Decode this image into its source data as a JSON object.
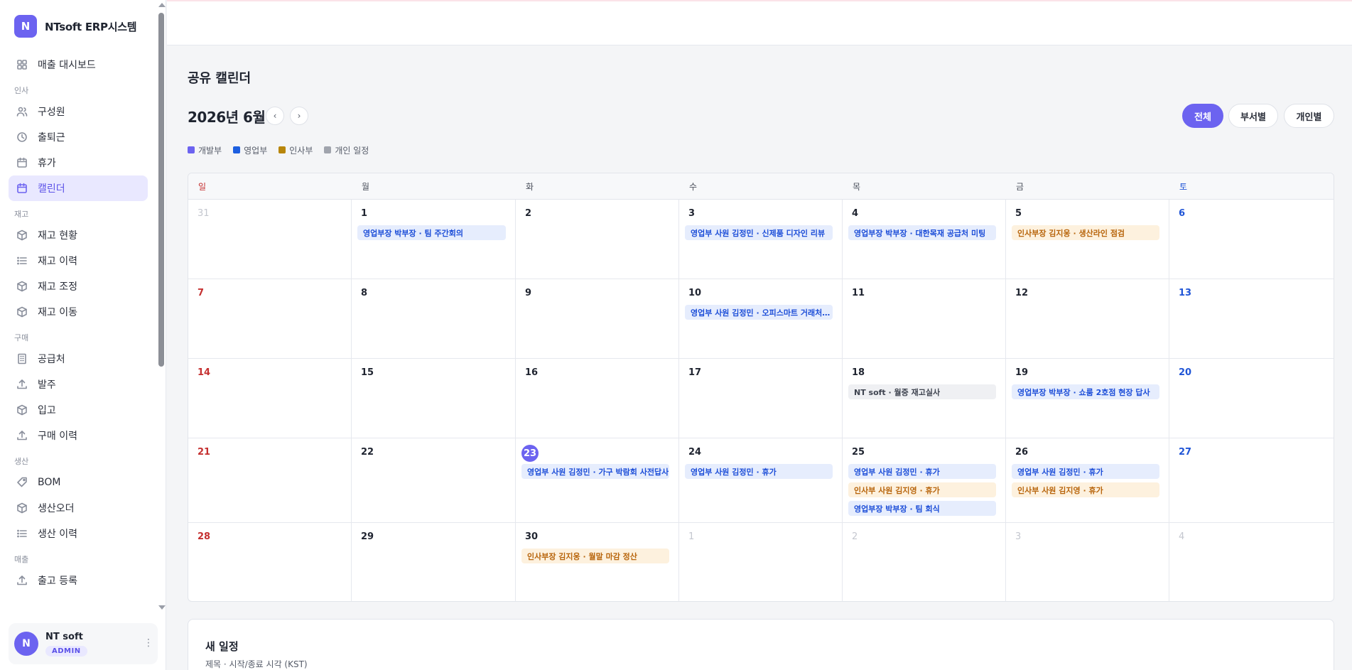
{
  "app": {
    "logo_letter": "N",
    "name": "NTsoft ERP시스템"
  },
  "sidebar": {
    "dashboard": {
      "label": "매출 대시보드",
      "icon": "grid-icon"
    },
    "sections": [
      {
        "title": "인사",
        "items": [
          {
            "label": "구성원",
            "icon": "users-icon"
          },
          {
            "label": "출퇴근",
            "icon": "clock-icon"
          },
          {
            "label": "휴가",
            "icon": "calendar-icon"
          },
          {
            "label": "캘린더",
            "icon": "calendar-icon",
            "active": true
          }
        ]
      },
      {
        "title": "재고",
        "items": [
          {
            "label": "재고 현황",
            "icon": "box-icon"
          },
          {
            "label": "재고 이력",
            "icon": "list-icon"
          },
          {
            "label": "재고 조정",
            "icon": "box-icon"
          },
          {
            "label": "재고 이동",
            "icon": "box-icon"
          }
        ]
      },
      {
        "title": "구매",
        "items": [
          {
            "label": "공급처",
            "icon": "building-icon"
          },
          {
            "label": "발주",
            "icon": "upload-icon"
          },
          {
            "label": "입고",
            "icon": "box-icon"
          },
          {
            "label": "구매 이력",
            "icon": "upload-icon"
          }
        ]
      },
      {
        "title": "생산",
        "items": [
          {
            "label": "BOM",
            "icon": "tag-icon"
          },
          {
            "label": "생산오더",
            "icon": "box-icon"
          },
          {
            "label": "생산 이력",
            "icon": "list-icon"
          }
        ]
      },
      {
        "title": "매출",
        "items": [
          {
            "label": "출고 등록",
            "icon": "upload-icon"
          }
        ]
      }
    ]
  },
  "user": {
    "avatar_letter": "N",
    "name": "NT soft",
    "role": "ADMIN",
    "more": "⋮"
  },
  "page": {
    "title": "공유 캘린더"
  },
  "calendar": {
    "month_label": "2026년 6월",
    "prev_label": "‹",
    "next_label": "›",
    "views": [
      {
        "label": "전체",
        "active": true
      },
      {
        "label": "부서별",
        "active": false
      },
      {
        "label": "개인별",
        "active": false
      }
    ],
    "legend": [
      {
        "label": "개발부",
        "color": "#6c63f0"
      },
      {
        "label": "영업부",
        "color": "#1d5fe0"
      },
      {
        "label": "인사부",
        "color": "#b8860b"
      },
      {
        "label": "개인 일정",
        "color": "#a0a4ad"
      }
    ],
    "weekdays": [
      "일",
      "월",
      "화",
      "수",
      "목",
      "금",
      "토"
    ],
    "weeks": [
      [
        {
          "day": "31",
          "muted": true,
          "events": []
        },
        {
          "day": "1",
          "events": [
            {
              "text": "영업부장 박부장 · 팀 주간회의",
              "type": "sales"
            }
          ]
        },
        {
          "day": "2",
          "events": []
        },
        {
          "day": "3",
          "events": [
            {
              "text": "영업부 사원 김정민 · 신제품 디자인 리뷰",
              "type": "sales"
            }
          ]
        },
        {
          "day": "4",
          "events": [
            {
              "text": "영업부장 박부장 · 대한목재 공급처 미팅",
              "type": "sales"
            }
          ]
        },
        {
          "day": "5",
          "events": [
            {
              "text": "인사부장 김지웅 · 생산라인 점검",
              "type": "hr"
            }
          ]
        },
        {
          "day": "6",
          "events": []
        }
      ],
      [
        {
          "day": "7",
          "events": []
        },
        {
          "day": "8",
          "events": []
        },
        {
          "day": "9",
          "events": []
        },
        {
          "day": "10",
          "events": [
            {
              "text": "영업부 사원 김정민 · 오피스마트 거래처 방문",
              "type": "sales"
            }
          ]
        },
        {
          "day": "11",
          "events": []
        },
        {
          "day": "12",
          "events": []
        },
        {
          "day": "13",
          "events": []
        }
      ],
      [
        {
          "day": "14",
          "events": []
        },
        {
          "day": "15",
          "events": []
        },
        {
          "day": "16",
          "events": []
        },
        {
          "day": "17",
          "events": []
        },
        {
          "day": "18",
          "events": [
            {
              "text": "NT soft · 월중 재고실사",
              "type": "personal"
            }
          ]
        },
        {
          "day": "19",
          "events": [
            {
              "text": "영업부장 박부장 · 쇼룸 2호점 현장 답사",
              "type": "sales"
            }
          ]
        },
        {
          "day": "20",
          "events": []
        }
      ],
      [
        {
          "day": "21",
          "events": []
        },
        {
          "day": "22",
          "events": []
        },
        {
          "day": "23",
          "today": true,
          "events": [
            {
              "text": "영업부 사원 김정민 · 가구 박람회 사전답사",
              "type": "sales"
            }
          ]
        },
        {
          "day": "24",
          "events": [
            {
              "text": "영업부 사원 김정민 · 휴가",
              "type": "sales"
            }
          ]
        },
        {
          "day": "25",
          "events": [
            {
              "text": "영업부 사원 김정민 · 휴가",
              "type": "sales"
            },
            {
              "text": "인사부 사원 김지영 · 휴가",
              "type": "hr"
            },
            {
              "text": "영업부장 박부장 · 팀 회식",
              "type": "sales"
            }
          ]
        },
        {
          "day": "26",
          "events": [
            {
              "text": "영업부 사원 김정민 · 휴가",
              "type": "sales"
            },
            {
              "text": "인사부 사원 김지영 · 휴가",
              "type": "hr"
            }
          ]
        },
        {
          "day": "27",
          "events": []
        }
      ],
      [
        {
          "day": "28",
          "events": []
        },
        {
          "day": "29",
          "events": []
        },
        {
          "day": "30",
          "events": [
            {
              "text": "인사부장 김지웅 · 월말 마감 정산",
              "type": "hr"
            }
          ]
        },
        {
          "day": "1",
          "muted": true,
          "events": []
        },
        {
          "day": "2",
          "muted": true,
          "events": []
        },
        {
          "day": "3",
          "muted": true,
          "events": []
        },
        {
          "day": "4",
          "muted": true,
          "events": []
        }
      ]
    ]
  },
  "new_schedule": {
    "title": "새 일정",
    "subtitle": "제목 · 시작/종료 시각 (KST)"
  }
}
